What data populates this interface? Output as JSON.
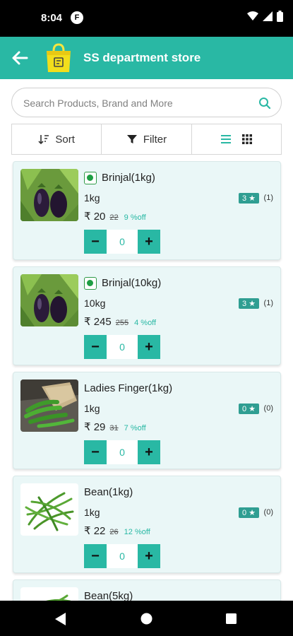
{
  "status": {
    "time": "8:04",
    "notif": "F"
  },
  "appbar": {
    "title": "SS department store"
  },
  "search": {
    "placeholder": "Search Products, Brand and More"
  },
  "toolbar": {
    "sort_label": "Sort",
    "filter_label": "Filter"
  },
  "products": [
    {
      "name": "Brinjal(1kg)",
      "qty": "1kg",
      "price": "₹ 20",
      "mrp": "22",
      "off": "9 %off",
      "rating": "3 ★",
      "rating_count": "(1)",
      "count": "0",
      "veg_mark": true,
      "image": "brinjal"
    },
    {
      "name": "Brinjal(10kg)",
      "qty": "10kg",
      "price": "₹ 245",
      "mrp": "255",
      "off": "4 %off",
      "rating": "3 ★",
      "rating_count": "(1)",
      "count": "0",
      "veg_mark": true,
      "image": "brinjal"
    },
    {
      "name": "Ladies Finger(1kg)",
      "qty": "1kg",
      "price": "₹ 29",
      "mrp": "31",
      "off": "7 %off",
      "rating": "0 ★",
      "rating_count": "(0)",
      "count": "0",
      "veg_mark": false,
      "image": "okra"
    },
    {
      "name": "Bean(1kg)",
      "qty": "1kg",
      "price": "₹ 22",
      "mrp": "26",
      "off": "12 %off",
      "rating": "0 ★",
      "rating_count": "(0)",
      "count": "0",
      "veg_mark": false,
      "image": "beans"
    },
    {
      "name": "Bean(5kg)",
      "image": "beans"
    }
  ],
  "colors": {
    "accent": "#29b8a4",
    "card_bg": "#eaf7f7",
    "veg_green": "#1e9e43"
  }
}
